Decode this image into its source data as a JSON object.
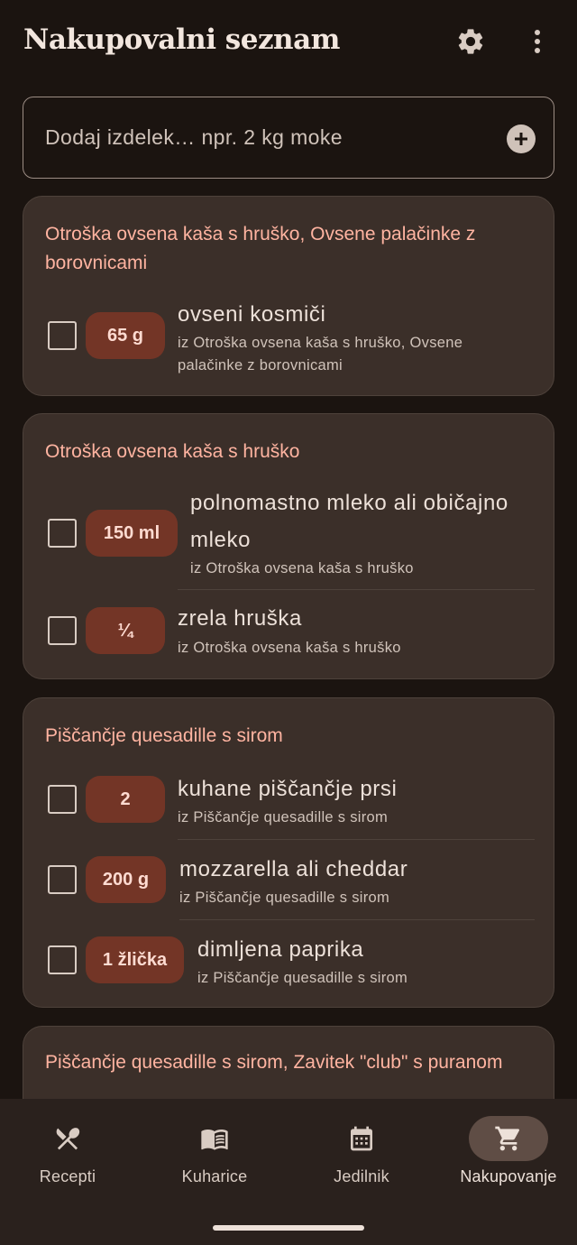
{
  "header": {
    "title": "Nakupovalni seznam",
    "settings_icon": "gear-icon",
    "more_icon": "more-vert-icon"
  },
  "add_item": {
    "placeholder": "Dodaj izdelek… npr. 2 kg moke",
    "value": "",
    "button_icon": "add-circle-icon"
  },
  "groups": [
    {
      "title": "Otroška ovsena kaša s hruško, Ovsene palačinke z borovnicami",
      "items": [
        {
          "checked": false,
          "qty": "65 g",
          "name": "ovseni kosmiči",
          "source": "iz Otroška ovsena kaša s hruško, Ovsene palačinke z borovnicami"
        }
      ]
    },
    {
      "title": "Otroška ovsena kaša s hruško",
      "items": [
        {
          "checked": false,
          "qty": "150 ml",
          "name": "polnomastno mleko ali običajno mleko",
          "source": "iz Otroška ovsena kaša s hruško"
        },
        {
          "checked": false,
          "qty": "¼",
          "name": "zrela hruška",
          "source": "iz Otroška ovsena kaša s hruško"
        }
      ]
    },
    {
      "title": "Piščančje quesadille s sirom",
      "items": [
        {
          "checked": false,
          "qty": "2",
          "name": "kuhane piščančje prsi",
          "source": "iz Piščančje quesadille s sirom"
        },
        {
          "checked": false,
          "qty": "200 g",
          "name": "mozzarella ali cheddar",
          "source": "iz Piščančje quesadille s sirom"
        },
        {
          "checked": false,
          "qty": "1 žlička",
          "name": "dimljena paprika",
          "source": "iz Piščančje quesadille s sirom"
        }
      ]
    },
    {
      "title": "Piščančje quesadille s sirom, Zavitek \"club\" s puranom",
      "items": []
    }
  ],
  "bottom_nav": {
    "items": [
      {
        "label": "Recepti",
        "icon": "fork-spoon-icon",
        "active": false
      },
      {
        "label": "Kuharice",
        "icon": "book-icon",
        "active": false
      },
      {
        "label": "Jedilnik",
        "icon": "calendar-icon",
        "active": false
      },
      {
        "label": "Nakupovanje",
        "icon": "cart-icon",
        "active": true
      }
    ]
  },
  "colors": {
    "background": "#1b1410",
    "card": "#3b2f29",
    "accent_title": "#ffb4a1",
    "qty_chip": "#733526",
    "active_nav_pill": "#5f4d45"
  }
}
